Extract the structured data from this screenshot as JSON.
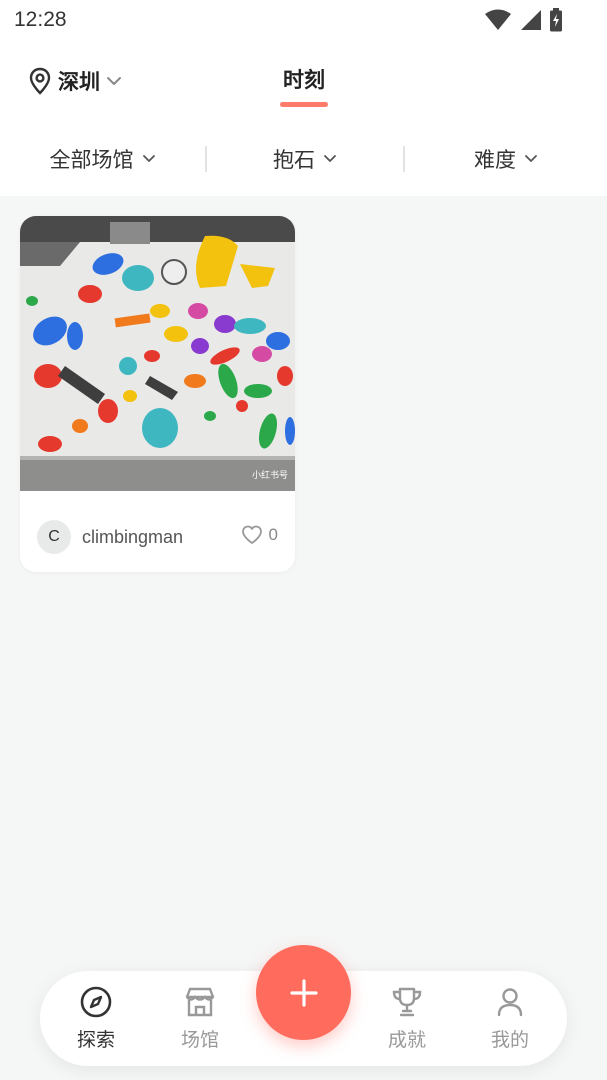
{
  "status_bar": {
    "time": "12:28"
  },
  "header": {
    "city": "深圳",
    "tab_label": "时刻",
    "accent_color": "#ff7a6a"
  },
  "filters": [
    {
      "label": "全部场馆"
    },
    {
      "label": "抱石"
    },
    {
      "label": "难度"
    }
  ],
  "posts": [
    {
      "avatar_letter": "C",
      "username": "climbingman",
      "likes": "0",
      "image_desc_icon": "climbing-wall-photo",
      "watermark": "小红书号"
    }
  ],
  "bottom_nav": {
    "items": [
      {
        "label": "探索",
        "icon": "compass-icon",
        "active": true
      },
      {
        "label": "场馆",
        "icon": "store-icon",
        "active": false
      },
      {
        "label": "成就",
        "icon": "trophy-icon",
        "active": false
      },
      {
        "label": "我的",
        "icon": "user-icon",
        "active": false
      }
    ],
    "fab_icon": "plus-icon",
    "fab_color": "#ff6b5d"
  }
}
